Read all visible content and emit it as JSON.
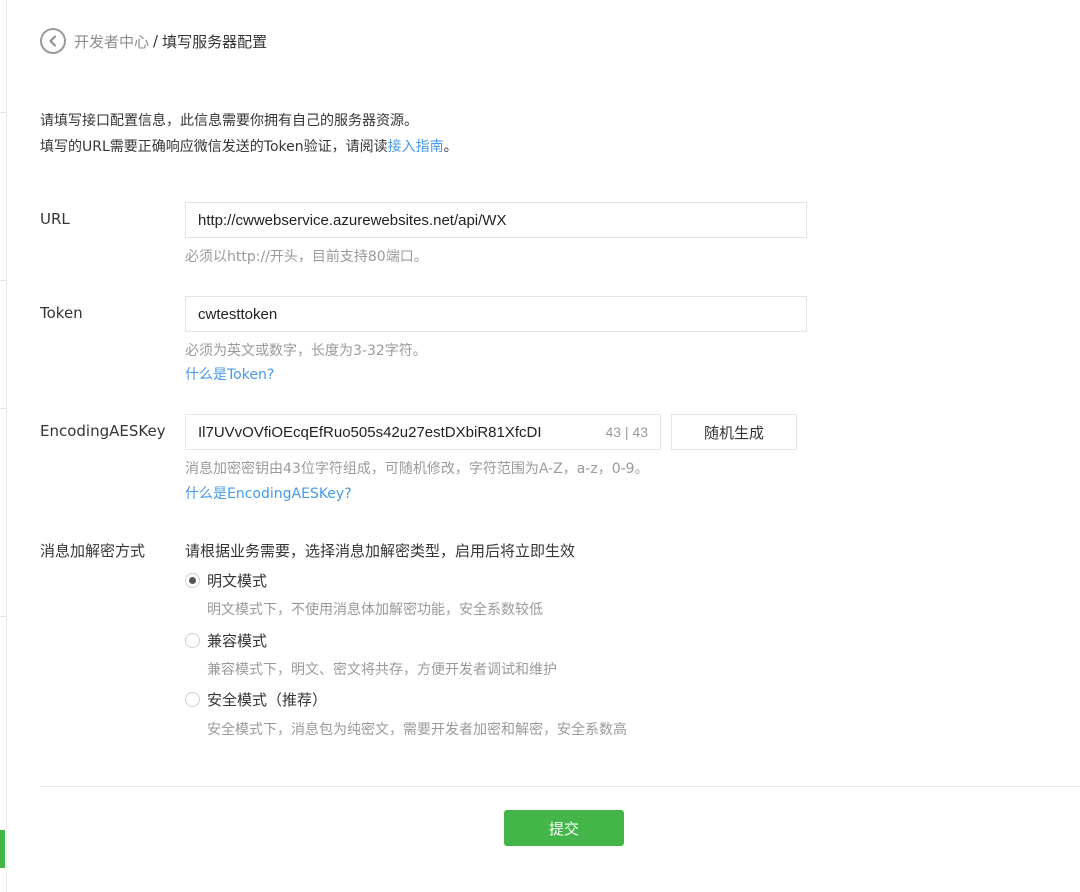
{
  "breadcrumb": {
    "parent": "开发者中心",
    "separator": "/",
    "current": "填写服务器配置"
  },
  "intro": {
    "line1": "请填写接口配置信息，此信息需要你拥有自己的服务器资源。",
    "line2_prefix": "填写的URL需要正确响应微信发送的Token验证，请阅读",
    "line2_link": "接入指南",
    "line2_suffix": "。"
  },
  "url": {
    "label": "URL",
    "value": "http://cwwebservice.azurewebsites.net/api/WX",
    "hint": "必须以http://开头，目前支持80端口。"
  },
  "token": {
    "label": "Token",
    "value": "cwtesttoken",
    "hint": "必须为英文或数字，长度为3-32字符。",
    "help_link": "什么是Token?"
  },
  "aeskey": {
    "label": "EncodingAESKey",
    "value": "Il7UVvOVfiOEcqEfRuo505s42u27estDXbiR81XfcDI",
    "counter": "43 | 43",
    "generate_label": "随机生成",
    "hint": "消息加密密钥由43位字符组成，可随机修改，字符范围为A-Z，a-z，0-9。",
    "help_link": "什么是EncodingAESKey?"
  },
  "encryption": {
    "label": "消息加解密方式",
    "prompt": "请根据业务需要，选择消息加解密类型，启用后将立即生效",
    "options": [
      {
        "label": "明文模式",
        "desc": "明文模式下，不使用消息体加解密功能，安全系数较低",
        "checked": true
      },
      {
        "label": "兼容模式",
        "desc": "兼容模式下，明文、密文将共存，方便开发者调试和维护",
        "checked": false
      },
      {
        "label": "安全模式（推荐）",
        "desc": "安全模式下，消息包为纯密文，需要开发者加密和解密，安全系数高",
        "checked": false
      }
    ]
  },
  "submit_label": "提交",
  "colors": {
    "accent_green": "#44b549",
    "link_blue": "#459ae9"
  }
}
